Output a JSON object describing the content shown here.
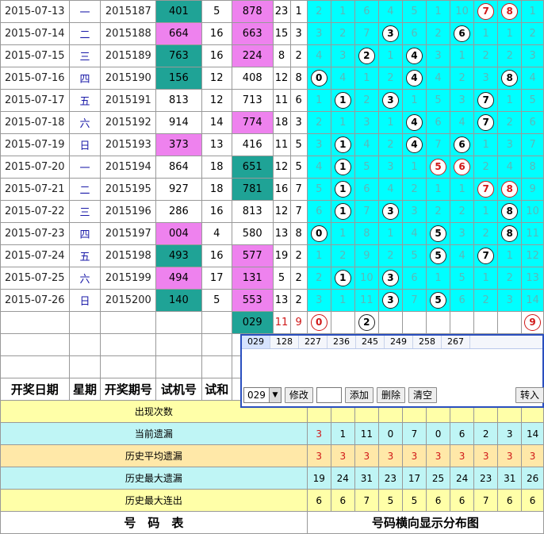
{
  "rows": [
    {
      "date": "2015-07-13",
      "week": "一",
      "issue": "2015187",
      "test": "401",
      "test_hl": "teal",
      "sp": "5",
      "draw": "878",
      "draw_hl": "pink",
      "sum": "23",
      "kd": "1",
      "dist": [
        [
          "2"
        ],
        [
          "1"
        ],
        [
          "6"
        ],
        [
          "4"
        ],
        [
          "5"
        ],
        [
          "1"
        ],
        [
          "10"
        ],
        [
          "7",
          "ball-red"
        ],
        [
          "8",
          "ball-red"
        ],
        [
          "1"
        ]
      ]
    },
    {
      "date": "2015-07-14",
      "week": "二",
      "issue": "2015188",
      "test": "664",
      "test_hl": "pink",
      "sp": "16",
      "draw": "663",
      "draw_hl": "pink",
      "sum": "15",
      "kd": "3",
      "dist": [
        [
          "3"
        ],
        [
          "2"
        ],
        [
          "7"
        ],
        [
          "3",
          "ball"
        ],
        [
          "6"
        ],
        [
          "2"
        ],
        [
          "6",
          "ball"
        ],
        [
          "1"
        ],
        [
          "1"
        ],
        [
          "2"
        ]
      ]
    },
    {
      "date": "2015-07-15",
      "week": "三",
      "issue": "2015189",
      "test": "763",
      "test_hl": "teal",
      "sp": "16",
      "draw": "224",
      "draw_hl": "pink",
      "sum": "8",
      "kd": "2",
      "dist": [
        [
          "4"
        ],
        [
          "3"
        ],
        [
          "2",
          "ball"
        ],
        [
          "1"
        ],
        [
          "4",
          "ball"
        ],
        [
          "3"
        ],
        [
          "1"
        ],
        [
          "2"
        ],
        [
          "2"
        ],
        [
          "3"
        ]
      ]
    },
    {
      "date": "2015-07-16",
      "week": "四",
      "issue": "2015190",
      "test": "156",
      "test_hl": "teal",
      "sp": "12",
      "draw": "408",
      "draw_hl": "",
      "sum": "12",
      "kd": "8",
      "dist": [
        [
          "0",
          "ball"
        ],
        [
          "4"
        ],
        [
          "1"
        ],
        [
          "2"
        ],
        [
          "4",
          "ball"
        ],
        [
          "4"
        ],
        [
          "2"
        ],
        [
          "3"
        ],
        [
          "8",
          "ball"
        ],
        [
          "4"
        ]
      ]
    },
    {
      "date": "2015-07-17",
      "week": "五",
      "issue": "2015191",
      "test": "813",
      "test_hl": "",
      "sp": "12",
      "draw": "713",
      "draw_hl": "",
      "sum": "11",
      "kd": "6",
      "dist": [
        [
          "1"
        ],
        [
          "1",
          "ball"
        ],
        [
          "2"
        ],
        [
          "3",
          "ball"
        ],
        [
          "1"
        ],
        [
          "5"
        ],
        [
          "3"
        ],
        [
          "7",
          "ball"
        ],
        [
          "1"
        ],
        [
          "5"
        ]
      ]
    },
    {
      "date": "2015-07-18",
      "week": "六",
      "issue": "2015192",
      "test": "914",
      "test_hl": "",
      "sp": "14",
      "draw": "774",
      "draw_hl": "pink",
      "sum": "18",
      "kd": "3",
      "dist": [
        [
          "2"
        ],
        [
          "1"
        ],
        [
          "3"
        ],
        [
          "1"
        ],
        [
          "4",
          "ball"
        ],
        [
          "6"
        ],
        [
          "4"
        ],
        [
          "7",
          "ball"
        ],
        [
          "2"
        ],
        [
          "6"
        ]
      ]
    },
    {
      "date": "2015-07-19",
      "week": "日",
      "issue": "2015193",
      "test": "373",
      "test_hl": "pink",
      "sp": "13",
      "draw": "416",
      "draw_hl": "",
      "sum": "11",
      "kd": "5",
      "dist": [
        [
          "3"
        ],
        [
          "1",
          "ball"
        ],
        [
          "4"
        ],
        [
          "2"
        ],
        [
          "4",
          "ball"
        ],
        [
          "7"
        ],
        [
          "6",
          "ball"
        ],
        [
          "1"
        ],
        [
          "3"
        ],
        [
          "7"
        ]
      ]
    },
    {
      "date": "2015-07-20",
      "week": "一",
      "issue": "2015194",
      "test": "864",
      "test_hl": "",
      "sp": "18",
      "draw": "651",
      "draw_hl": "teal",
      "sum": "12",
      "kd": "5",
      "dist": [
        [
          "4"
        ],
        [
          "1",
          "ball"
        ],
        [
          "5"
        ],
        [
          "3"
        ],
        [
          "1"
        ],
        [
          "5",
          "ball-red"
        ],
        [
          "6",
          "ball-red"
        ],
        [
          "2"
        ],
        [
          "4"
        ],
        [
          "8"
        ]
      ]
    },
    {
      "date": "2015-07-21",
      "week": "二",
      "issue": "2015195",
      "test": "927",
      "test_hl": "",
      "sp": "18",
      "draw": "781",
      "draw_hl": "teal",
      "sum": "16",
      "kd": "7",
      "dist": [
        [
          "5"
        ],
        [
          "1",
          "ball"
        ],
        [
          "6"
        ],
        [
          "4"
        ],
        [
          "2"
        ],
        [
          "1"
        ],
        [
          "1"
        ],
        [
          "7",
          "ball-red"
        ],
        [
          "8",
          "ball-red"
        ],
        [
          "9"
        ]
      ]
    },
    {
      "date": "2015-07-22",
      "week": "三",
      "issue": "2015196",
      "test": "286",
      "test_hl": "",
      "sp": "16",
      "draw": "813",
      "draw_hl": "",
      "sum": "12",
      "kd": "7",
      "dist": [
        [
          "6"
        ],
        [
          "1",
          "ball"
        ],
        [
          "7"
        ],
        [
          "3",
          "ball"
        ],
        [
          "3"
        ],
        [
          "2"
        ],
        [
          "2"
        ],
        [
          "1"
        ],
        [
          "8",
          "ball"
        ],
        [
          "10"
        ]
      ]
    },
    {
      "date": "2015-07-23",
      "week": "四",
      "issue": "2015197",
      "test": "004",
      "test_hl": "pink",
      "sp": "4",
      "draw": "580",
      "draw_hl": "",
      "sum": "13",
      "kd": "8",
      "dist": [
        [
          "0",
          "ball"
        ],
        [
          "1"
        ],
        [
          "8"
        ],
        [
          "1"
        ],
        [
          "4"
        ],
        [
          "5",
          "ball"
        ],
        [
          "3"
        ],
        [
          "2"
        ],
        [
          "8",
          "ball"
        ],
        [
          "11"
        ]
      ]
    },
    {
      "date": "2015-07-24",
      "week": "五",
      "issue": "2015198",
      "test": "493",
      "test_hl": "teal",
      "sp": "16",
      "draw": "577",
      "draw_hl": "pink",
      "sum": "19",
      "kd": "2",
      "dist": [
        [
          "1"
        ],
        [
          "2"
        ],
        [
          "9"
        ],
        [
          "2"
        ],
        [
          "5"
        ],
        [
          "5",
          "ball"
        ],
        [
          "4"
        ],
        [
          "7",
          "ball"
        ],
        [
          "1"
        ],
        [
          "12"
        ]
      ]
    },
    {
      "date": "2015-07-25",
      "week": "六",
      "issue": "2015199",
      "test": "494",
      "test_hl": "pink",
      "sp": "17",
      "draw": "131",
      "draw_hl": "pink",
      "sum": "5",
      "kd": "2",
      "dist": [
        [
          "2"
        ],
        [
          "1",
          "ball"
        ],
        [
          "10"
        ],
        [
          "3",
          "ball"
        ],
        [
          "6"
        ],
        [
          "1"
        ],
        [
          "5"
        ],
        [
          "1"
        ],
        [
          "2"
        ],
        [
          "13"
        ]
      ]
    },
    {
      "date": "2015-07-26",
      "week": "日",
      "issue": "2015200",
      "test": "140",
      "test_hl": "teal",
      "sp": "5",
      "draw": "553",
      "draw_hl": "pink",
      "sum": "13",
      "kd": "2",
      "dist": [
        [
          "3"
        ],
        [
          "1"
        ],
        [
          "11"
        ],
        [
          "3",
          "ball"
        ],
        [
          "7"
        ],
        [
          "5",
          "ball"
        ],
        [
          "6"
        ],
        [
          "2"
        ],
        [
          "3"
        ],
        [
          "14"
        ]
      ]
    }
  ],
  "predict_row": {
    "draw": "029",
    "sum": "11",
    "kd": "9",
    "dist": [
      [
        "0",
        "ball-red"
      ],
      [
        ""
      ],
      [
        "2",
        "ball"
      ],
      [
        ""
      ],
      [
        ""
      ],
      [
        ""
      ],
      [
        ""
      ],
      [
        ""
      ],
      [
        ""
      ],
      [
        "9",
        "ball-red"
      ]
    ]
  },
  "headers": {
    "date": "开奖日期",
    "week": "星期",
    "issue": "开奖期号",
    "test": "试机号",
    "sp": "试和"
  },
  "stats": [
    {
      "label": "出现次数",
      "cls": "y1",
      "values": [
        "",
        "",
        "",
        "",
        "",
        "",
        "",
        "",
        "",
        ""
      ]
    },
    {
      "label": "当前遗漏",
      "cls": "y2",
      "values": [
        "3",
        "1",
        "11",
        "0",
        "7",
        "0",
        "6",
        "2",
        "3",
        "14"
      ],
      "red_first": true
    },
    {
      "label": "历史平均遗漏",
      "cls": "y3",
      "values": [
        "3",
        "3",
        "3",
        "3",
        "3",
        "3",
        "3",
        "3",
        "3",
        "3"
      ],
      "all_red": true
    },
    {
      "label": "历史最大遗漏",
      "cls": "y2",
      "values": [
        "19",
        "24",
        "31",
        "23",
        "17",
        "25",
        "24",
        "23",
        "31",
        "26"
      ]
    },
    {
      "label": "历史最大连出",
      "cls": "y1",
      "values": [
        "6",
        "6",
        "7",
        "5",
        "5",
        "6",
        "6",
        "7",
        "6",
        "6"
      ]
    }
  ],
  "footer": {
    "left": "号　码　表",
    "right": "号码横向显示分布图"
  },
  "panel": {
    "tabs": [
      "029",
      "128",
      "227",
      "236",
      "245",
      "249",
      "258",
      "267"
    ],
    "select_value": "029",
    "buttons": {
      "modify": "修改",
      "add": "添加",
      "delete": "删除",
      "clear": "清空",
      "transfer": "转入"
    }
  }
}
